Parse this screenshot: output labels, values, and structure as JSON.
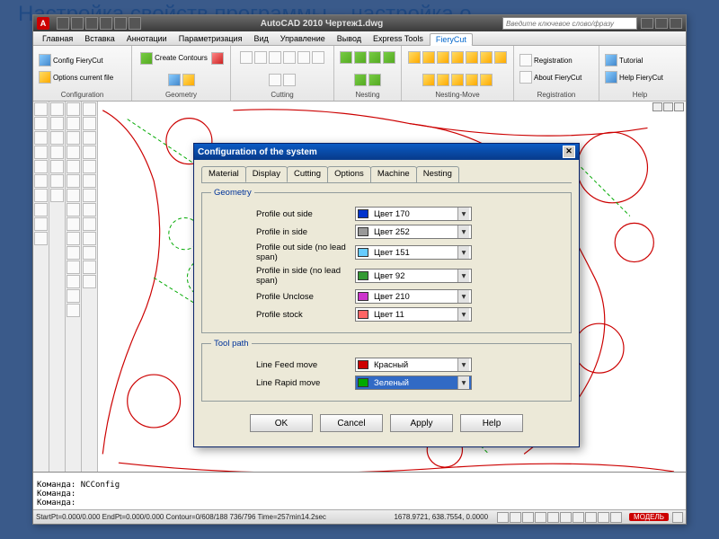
{
  "slide_title": "Настройка свойств программы – настройка о",
  "window": {
    "app_title": "AutoCAD 2010    Чертеж1.dwg",
    "logo_text": "A",
    "search_placeholder": "Введите ключевое слово/фразу"
  },
  "menu": {
    "items": [
      "Главная",
      "Вставка",
      "Аннотации",
      "Параметризация",
      "Вид",
      "Управление",
      "Вывод",
      "Express Tools",
      "FieryCut"
    ],
    "active_index": 8
  },
  "ribbon": {
    "panels": [
      {
        "label": "Configuration",
        "items": [
          "Config FieryCut",
          "Options current file"
        ]
      },
      {
        "label": "Geometry",
        "items": [
          "Create Contours"
        ]
      },
      {
        "label": "Cutting",
        "items": []
      },
      {
        "label": "Nesting",
        "items": []
      },
      {
        "label": "Nesting-Move",
        "items": []
      },
      {
        "label": "Registration",
        "items": [
          "Registration",
          "About FieryCut"
        ]
      },
      {
        "label": "Help",
        "items": [
          "Tutorial",
          "Help FieryCut"
        ]
      }
    ]
  },
  "dialog": {
    "title": "Configuration of the system",
    "tabs": [
      "Material",
      "Display",
      "Cutting",
      "Options",
      "Machine",
      "Nesting"
    ],
    "active_tab": 1,
    "groups": {
      "geometry": {
        "legend": "Geometry",
        "rows": [
          {
            "label": "Profile out side",
            "color": "#0033cc",
            "value": "Цвет 170"
          },
          {
            "label": "Profile in side",
            "color": "#999999",
            "value": "Цвет 252"
          },
          {
            "label": "Profile out side (no lead span)",
            "color": "#66ccff",
            "value": "Цвет 151"
          },
          {
            "label": "Profile in side (no lead span)",
            "color": "#339933",
            "value": "Цвет 92"
          },
          {
            "label": "Profile Unclose",
            "color": "#cc33cc",
            "value": "Цвет 210"
          },
          {
            "label": "Profile stock",
            "color": "#ff6666",
            "value": "Цвет 11"
          }
        ]
      },
      "toolpath": {
        "legend": "Tool path",
        "rows": [
          {
            "label": "Line Feed move",
            "color": "#cc0000",
            "value": "Красный",
            "selected": false
          },
          {
            "label": "Line Rapid move",
            "color": "#00aa00",
            "value": "Зеленый",
            "selected": true
          }
        ]
      }
    },
    "buttons": [
      "OK",
      "Cancel",
      "Apply",
      "Help"
    ]
  },
  "command": {
    "lines": [
      "Команда: NCConfig",
      "Команда:",
      "Команда:"
    ]
  },
  "status": {
    "left": "StartPt=0.000/0.000   EndPt=0.000/0.000   Contour=0/608/188   736/796 Time=257min14.2sec",
    "coords": "1678.9721, 638.7554, 0.0000",
    "model": "МОДЕЛЬ"
  }
}
